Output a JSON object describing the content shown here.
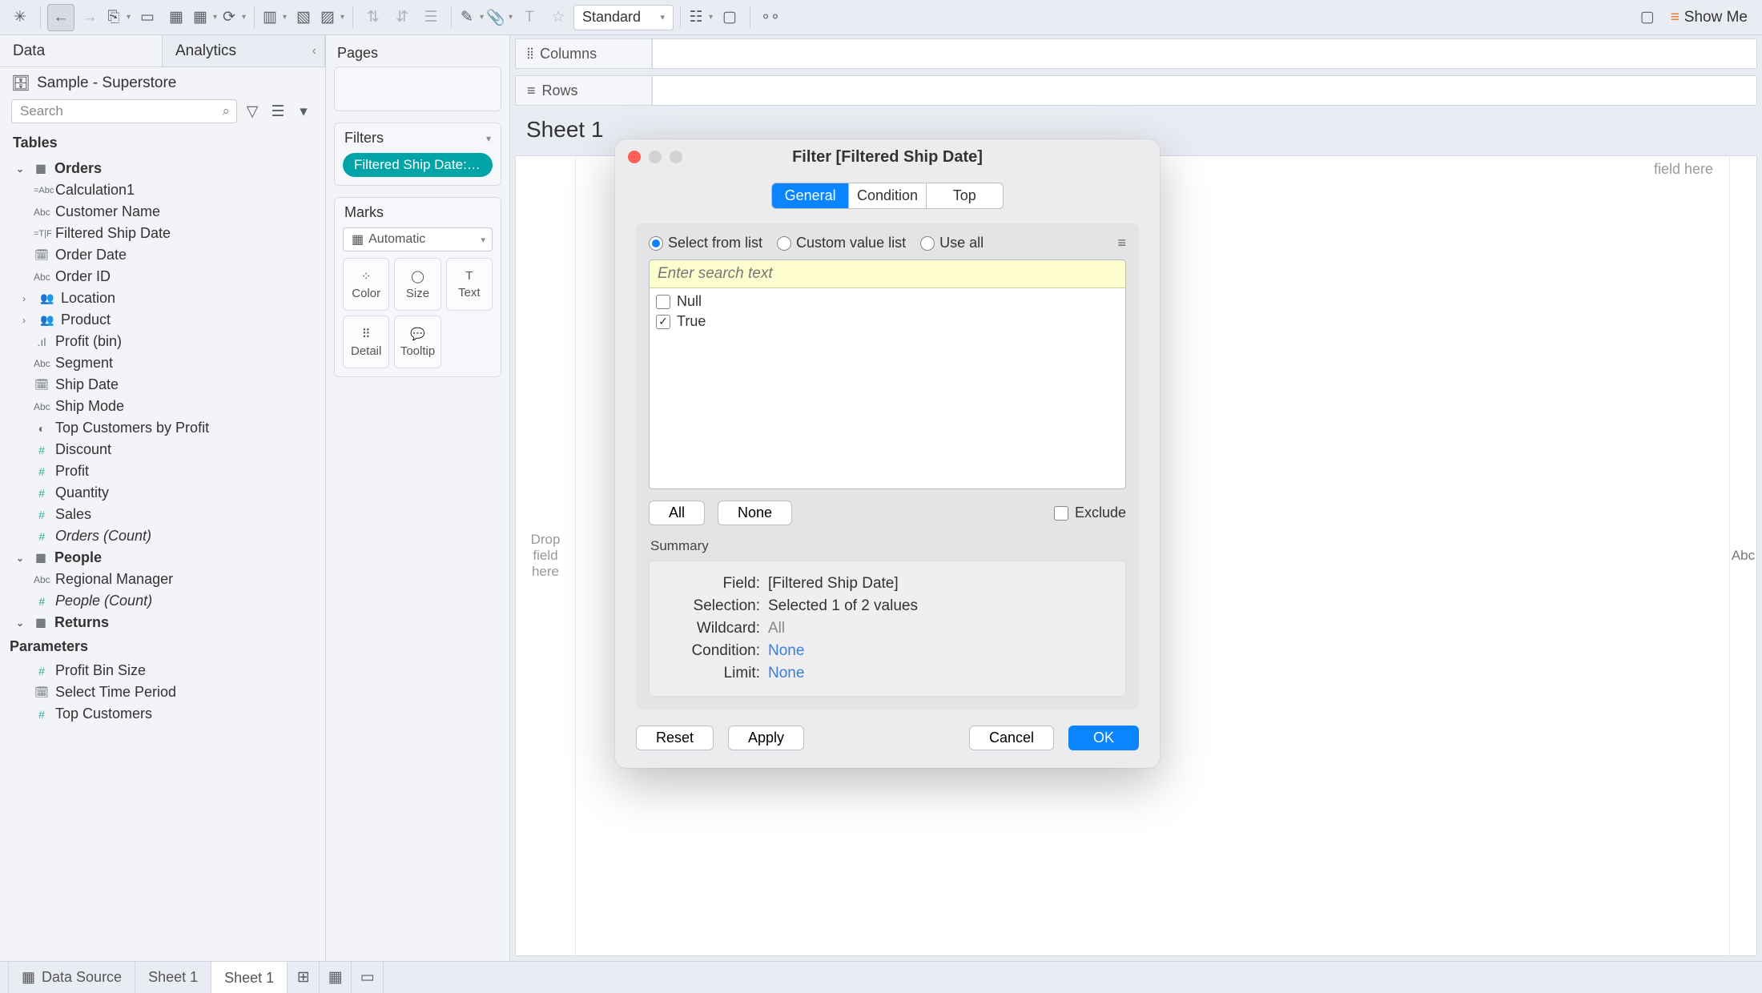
{
  "toolbar": {
    "fit_mode": "Standard",
    "show_me": "Show Me"
  },
  "left_panel": {
    "tabs": {
      "data": "Data",
      "analytics": "Analytics"
    },
    "datasource": "Sample - Superstore",
    "search_placeholder": "Search",
    "tables_label": "Tables",
    "tables": {
      "orders": {
        "name": "Orders",
        "fields": [
          {
            "icon": "=Abc",
            "label": "Calculation1"
          },
          {
            "icon": "Abc",
            "label": "Customer Name"
          },
          {
            "icon": "=T|F",
            "label": "Filtered Ship Date"
          },
          {
            "icon": "🗓",
            "label": "Order Date"
          },
          {
            "icon": "Abc",
            "label": "Order ID"
          },
          {
            "icon": "⌂",
            "label": "Location",
            "expandable": true
          },
          {
            "icon": "👥",
            "label": "Product",
            "expandable": true
          },
          {
            "icon": ".ıl",
            "label": "Profit (bin)"
          },
          {
            "icon": "Abc",
            "label": "Segment"
          },
          {
            "icon": "🗓",
            "label": "Ship Date"
          },
          {
            "icon": "Abc",
            "label": "Ship Mode"
          },
          {
            "icon": "◐",
            "label": "Top Customers by Profit"
          },
          {
            "icon": "#",
            "label": "Discount"
          },
          {
            "icon": "#",
            "label": "Profit"
          },
          {
            "icon": "#",
            "label": "Quantity"
          },
          {
            "icon": "#",
            "label": "Sales"
          },
          {
            "icon": "#",
            "label": "Orders (Count)",
            "italic": true
          }
        ]
      },
      "people": {
        "name": "People",
        "fields": [
          {
            "icon": "Abc",
            "label": "Regional Manager"
          },
          {
            "icon": "#",
            "label": "People (Count)",
            "italic": true
          }
        ]
      },
      "returns": {
        "name": "Returns"
      }
    },
    "parameters_label": "Parameters",
    "parameters": [
      {
        "icon": "#",
        "label": "Profit Bin Size"
      },
      {
        "icon": "🗓",
        "label": "Select Time Period"
      },
      {
        "icon": "#",
        "label": "Top Customers"
      }
    ]
  },
  "mid_panel": {
    "pages": "Pages",
    "filters": "Filters",
    "filter_pill": "Filtered Ship Date: Tr..",
    "marks": "Marks",
    "marks_mode": "Automatic",
    "cells": {
      "color": "Color",
      "size": "Size",
      "text": "Text",
      "detail": "Detail",
      "tooltip": "Tooltip"
    }
  },
  "shelves": {
    "columns": "Columns",
    "rows": "Rows"
  },
  "sheet": {
    "title": "Sheet 1",
    "drop_left": "Drop\nfield\nhere",
    "drop_right_hint": "field here",
    "abc": "Abc"
  },
  "bottom": {
    "data_source": "Data Source",
    "sheet1a": "Sheet 1",
    "sheet1b": "Sheet 1"
  },
  "dialog": {
    "title": "Filter [Filtered Ship Date]",
    "tabs": {
      "general": "General",
      "condition": "Condition",
      "top": "Top"
    },
    "radios": {
      "select": "Select from list",
      "custom": "Custom value list",
      "use_all": "Use all"
    },
    "search_placeholder": "Enter search text",
    "items": [
      {
        "label": "Null",
        "checked": false
      },
      {
        "label": "True",
        "checked": true
      }
    ],
    "buttons": {
      "all": "All",
      "none": "None",
      "exclude": "Exclude",
      "reset": "Reset",
      "apply": "Apply",
      "cancel": "Cancel",
      "ok": "OK"
    },
    "summary_label": "Summary",
    "summary": {
      "field_k": "Field:",
      "field_v": "[Filtered Ship Date]",
      "selection_k": "Selection:",
      "selection_v": "Selected 1 of 2 values",
      "wildcard_k": "Wildcard:",
      "wildcard_v": "All",
      "condition_k": "Condition:",
      "condition_v": "None",
      "limit_k": "Limit:",
      "limit_v": "None"
    }
  }
}
